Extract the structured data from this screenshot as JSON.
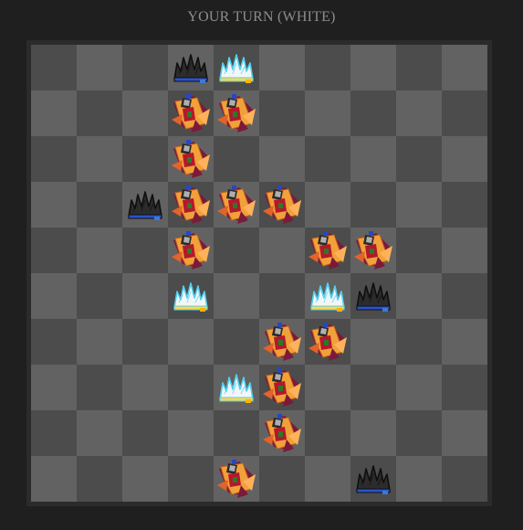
{
  "status": {
    "turn_label": "YOUR TURN (WHITE)"
  },
  "board": {
    "size": 10,
    "colors": {
      "dark": "#4c4c4c",
      "light": "#626262",
      "frame": "#2b2b2b",
      "background": "#1f1f1f"
    },
    "pieces": [
      {
        "row": 0,
        "col": 3,
        "kind": "black-crown"
      },
      {
        "row": 0,
        "col": 4,
        "kind": "white-crown"
      },
      {
        "row": 1,
        "col": 3,
        "kind": "arrow"
      },
      {
        "row": 1,
        "col": 4,
        "kind": "arrow"
      },
      {
        "row": 2,
        "col": 3,
        "kind": "arrow"
      },
      {
        "row": 3,
        "col": 2,
        "kind": "black-crown"
      },
      {
        "row": 3,
        "col": 3,
        "kind": "arrow"
      },
      {
        "row": 3,
        "col": 4,
        "kind": "arrow"
      },
      {
        "row": 3,
        "col": 5,
        "kind": "arrow"
      },
      {
        "row": 4,
        "col": 3,
        "kind": "arrow"
      },
      {
        "row": 4,
        "col": 6,
        "kind": "arrow"
      },
      {
        "row": 4,
        "col": 7,
        "kind": "arrow"
      },
      {
        "row": 5,
        "col": 3,
        "kind": "white-crown"
      },
      {
        "row": 5,
        "col": 6,
        "kind": "white-crown"
      },
      {
        "row": 5,
        "col": 7,
        "kind": "black-crown"
      },
      {
        "row": 6,
        "col": 5,
        "kind": "arrow"
      },
      {
        "row": 6,
        "col": 6,
        "kind": "arrow"
      },
      {
        "row": 7,
        "col": 4,
        "kind": "white-crown"
      },
      {
        "row": 7,
        "col": 5,
        "kind": "arrow"
      },
      {
        "row": 8,
        "col": 5,
        "kind": "arrow"
      },
      {
        "row": 9,
        "col": 4,
        "kind": "arrow"
      },
      {
        "row": 9,
        "col": 7,
        "kind": "black-crown"
      }
    ]
  }
}
